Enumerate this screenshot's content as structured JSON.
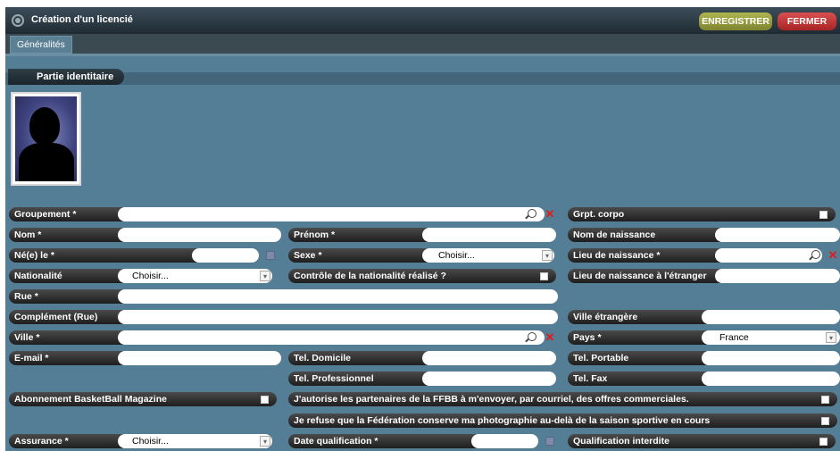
{
  "window": {
    "title": "Création d'un licencié",
    "save_label": "ENREGISTRER",
    "close_label": "FERMER"
  },
  "tabs": [
    {
      "label": "Généralités"
    }
  ],
  "section": {
    "title": "Partie identitaire"
  },
  "colors": {
    "save": "#9aa041",
    "close": "#c53434",
    "panel": "#547e96",
    "label": "#2a2a2a"
  },
  "fields": {
    "groupement": {
      "label": "Groupement *",
      "value": ""
    },
    "grpt_corpo": {
      "label": "Grpt. corpo",
      "checked": false
    },
    "nom": {
      "label": "Nom *",
      "value": ""
    },
    "prenom": {
      "label": "Prénom *",
      "value": ""
    },
    "nom_naissance": {
      "label": "Nom de naissance",
      "value": ""
    },
    "ne_le": {
      "label": "Né(e) le *",
      "value": ""
    },
    "sexe": {
      "label": "Sexe *",
      "value": "Choisir..."
    },
    "lieu_naissance": {
      "label": "Lieu de naissance *",
      "value": ""
    },
    "nationalite": {
      "label": "Nationalité",
      "value": "Choisir..."
    },
    "controle_nationalite": {
      "label": "Contrôle de la nationalité réalisé ?",
      "checked": false
    },
    "lieu_etranger": {
      "label": "Lieu de naissance à l'étranger",
      "value": ""
    },
    "rue": {
      "label": "Rue *",
      "value": ""
    },
    "complement": {
      "label": "Complément (Rue)",
      "value": ""
    },
    "ville_etrangere": {
      "label": "Ville étrangère",
      "value": ""
    },
    "ville": {
      "label": "Ville *",
      "value": ""
    },
    "pays": {
      "label": "Pays *",
      "value": "France"
    },
    "email": {
      "label": "E-mail *",
      "value": ""
    },
    "tel_domicile": {
      "label": "Tel. Domicile",
      "value": ""
    },
    "tel_portable": {
      "label": "Tel. Portable",
      "value": ""
    },
    "tel_pro": {
      "label": "Tel. Professionnel",
      "value": ""
    },
    "tel_fax": {
      "label": "Tel. Fax",
      "value": ""
    },
    "abonnement": {
      "label": "Abonnement BasketBall Magazine",
      "checked": false
    },
    "partenaires": {
      "label": "J'autorise les partenaires de la FFBB à m'envoyer, par courriel, des offres commerciales.",
      "checked": false
    },
    "photo_refus": {
      "label": "Je refuse que la Fédération conserve ma photographie au-delà de la saison sportive en cours",
      "checked": false
    },
    "assurance": {
      "label": "Assurance *",
      "value": "Choisir..."
    },
    "date_qualif": {
      "label": "Date qualification *",
      "value": ""
    },
    "qualif_interdite": {
      "label": "Qualification interdite",
      "checked": false
    }
  },
  "icons": [
    "app-icon",
    "search-icon",
    "clear-icon",
    "calendar-icon",
    "dropdown-arrow-icon",
    "checkbox-icon"
  ]
}
